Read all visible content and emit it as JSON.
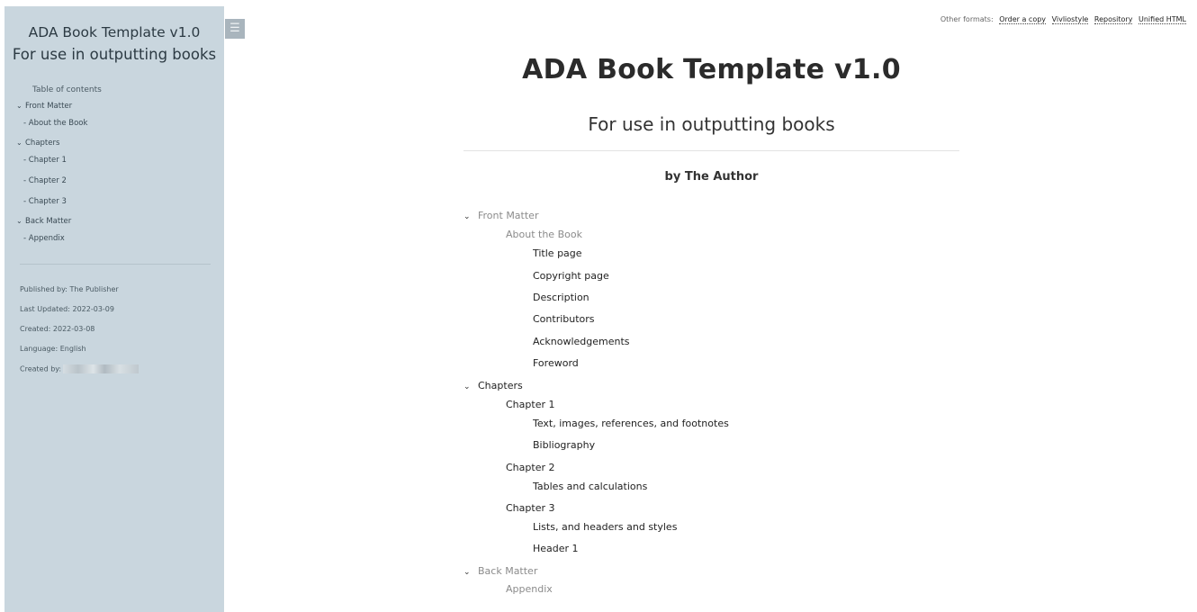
{
  "sidebar": {
    "title": "ADA Book Template v1.0",
    "subtitle": "For use in outputting books",
    "toc_label": "Table of contents",
    "items": [
      {
        "label": "Front Matter",
        "chev": "⌄"
      },
      {
        "label": "- About the Book"
      },
      {
        "label": "Chapters",
        "chev": "⌄"
      },
      {
        "label": "- Chapter 1"
      },
      {
        "label": "- Chapter 2"
      },
      {
        "label": "- Chapter 3"
      },
      {
        "label": "Back Matter",
        "chev": "⌄"
      },
      {
        "label": "- Appendix"
      }
    ],
    "meta": {
      "published": "Published by: The Publisher",
      "updated": "Last Updated: 2022-03-09",
      "created": "Created: 2022-03-08",
      "language": "Language: English",
      "created_by": "Created by:"
    }
  },
  "menu_icon": "☰",
  "formats": {
    "label": "Other formats:",
    "links": [
      "Order a copy",
      "Vivliostyle",
      "Repository",
      "Unified HTML"
    ]
  },
  "main": {
    "title": "ADA Book Template v1.0",
    "subtitle": "For use in outputting books",
    "author": "by The Author",
    "toc": {
      "front_matter": "Front Matter",
      "about_book": "About the Book",
      "front_items": [
        "Title page",
        "Copyright page",
        "Description",
        "Contributors",
        "Acknowledgements",
        "Foreword"
      ],
      "chapters": "Chapters",
      "chapter1": "Chapter 1",
      "chapter1_items": [
        "Text, images, references, and footnotes",
        "Bibliography"
      ],
      "chapter2": "Chapter 2",
      "chapter2_items": [
        "Tables and calculations"
      ],
      "chapter3": "Chapter 3",
      "chapter3_items": [
        "Lists, and headers and styles",
        "Header 1"
      ],
      "back_matter": "Back Matter",
      "appendix": "Appendix"
    }
  }
}
